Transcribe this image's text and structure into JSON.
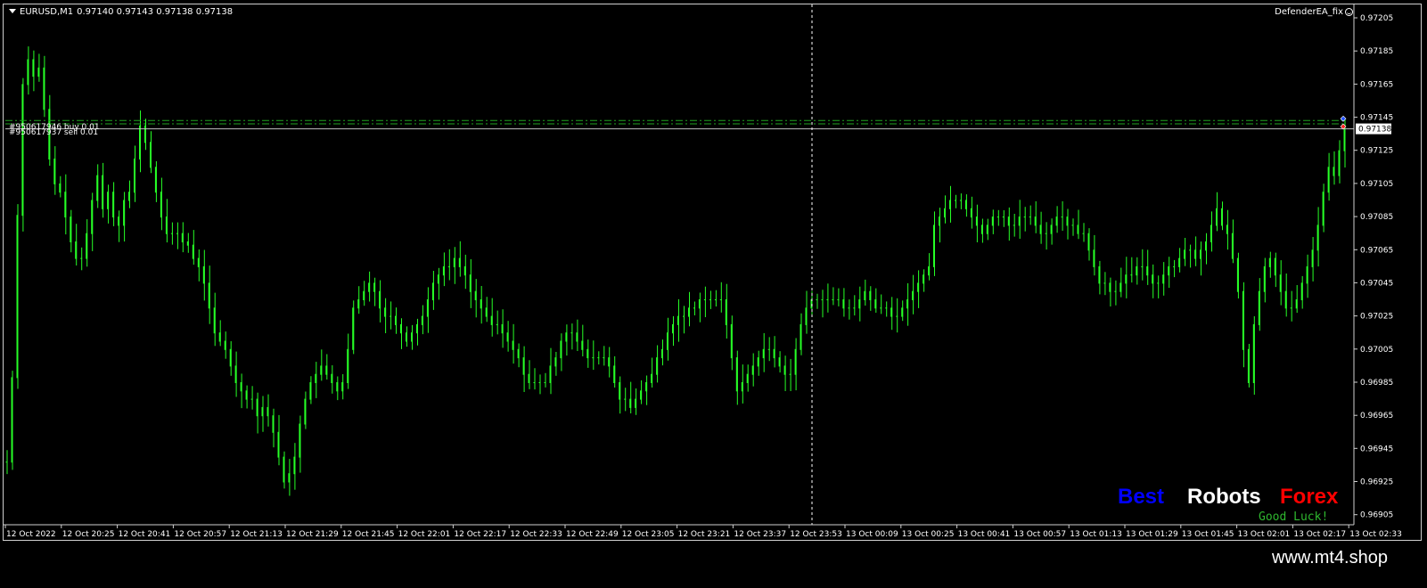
{
  "header": {
    "symbol": "EURUSD,M1",
    "prices": "0.97140 0.97143 0.97138 0.97138",
    "ea_name": "DefenderEA_fix"
  },
  "orders": [
    {
      "label": "#950617946 buy 0.01",
      "price": 0.97143
    },
    {
      "label": "#950617937 sell 0.01",
      "price": 0.97141
    }
  ],
  "current_price_label": "0.97138",
  "brand": {
    "word1": "Best",
    "word1_color": "#0000ff",
    "word2": "Robots",
    "word2_color": "#ffffff",
    "word3": "Forex",
    "word3_color": "#ff0000",
    "subtitle": "Good Luck!",
    "subtitle_color": "#2fb82f"
  },
  "footer": {
    "site": "www.mt4.shop"
  },
  "colors": {
    "candle": "#26ff26",
    "order_line": "#1fa31f",
    "bid_line": "#c0c0c0",
    "grid_text": "#ffffff"
  },
  "chart_data": {
    "type": "candlestick",
    "y_ticks": [
      "0.97205",
      "0.97185",
      "0.97165",
      "0.97145",
      "0.97125",
      "0.97105",
      "0.97085",
      "0.97065",
      "0.97045",
      "0.97025",
      "0.97005",
      "0.96985",
      "0.96965",
      "0.96945",
      "0.96925",
      "0.96905"
    ],
    "ylim": [
      0.969,
      0.97212
    ],
    "x_ticks": [
      "12 Oct 2022",
      "12 Oct 20:25",
      "12 Oct 20:41",
      "12 Oct 20:57",
      "12 Oct 21:13",
      "12 Oct 21:29",
      "12 Oct 21:45",
      "12 Oct 22:01",
      "12 Oct 22:17",
      "12 Oct 22:33",
      "12 Oct 22:49",
      "12 Oct 23:05",
      "12 Oct 23:21",
      "12 Oct 23:37",
      "12 Oct 23:53",
      "13 Oct 00:09",
      "13 Oct 00:25",
      "13 Oct 00:41",
      "13 Oct 00:57",
      "13 Oct 01:13",
      "13 Oct 01:29",
      "13 Oct 01:45",
      "13 Oct 02:01",
      "13 Oct 02:17",
      "13 Oct 02:33"
    ],
    "series": [
      {
        "name": "EURUSD,M1",
        "values": [
          0.96937,
          0.96988,
          0.97086,
          0.97165,
          0.9718,
          0.9717,
          0.97175,
          0.9715,
          0.9712,
          0.97105,
          0.971,
          0.97085,
          0.9707,
          0.9706,
          0.9706,
          0.97075,
          0.97095,
          0.9711,
          0.9709,
          0.971,
          0.97085,
          0.9708,
          0.97095,
          0.971,
          0.9712,
          0.9714,
          0.9713,
          0.97115,
          0.971,
          0.97085,
          0.97075,
          0.97075,
          0.97075,
          0.9707,
          0.97068,
          0.9706,
          0.97055,
          0.97045,
          0.9703,
          0.97015,
          0.9701,
          0.97005,
          0.96995,
          0.96985,
          0.9698,
          0.96975,
          0.96975,
          0.96965,
          0.9697,
          0.96965,
          0.96955,
          0.9694,
          0.96925,
          0.9693,
          0.9694,
          0.9696,
          0.96975,
          0.96985,
          0.9699,
          0.96995,
          0.9699,
          0.96985,
          0.9698,
          0.96985,
          0.97005,
          0.9703,
          0.97035,
          0.9704,
          0.97045,
          0.9704,
          0.9703,
          0.97025,
          0.97025,
          0.9702,
          0.97015,
          0.9701,
          0.97015,
          0.9702,
          0.97025,
          0.97035,
          0.97045,
          0.9705,
          0.97055,
          0.97055,
          0.9706,
          0.97055,
          0.9705,
          0.9704,
          0.97035,
          0.9703,
          0.97025,
          0.9702,
          0.9702,
          0.97015,
          0.9701,
          0.97005,
          0.97,
          0.9699,
          0.96985,
          0.96985,
          0.96985,
          0.96985,
          0.96995,
          0.97,
          0.9701,
          0.97015,
          0.97015,
          0.9701,
          0.97005,
          0.97,
          0.97,
          0.97,
          0.97,
          0.96995,
          0.96985,
          0.96975,
          0.96975,
          0.9697,
          0.96975,
          0.9698,
          0.96985,
          0.9699,
          0.97,
          0.97005,
          0.97015,
          0.9702,
          0.97025,
          0.97025,
          0.9703,
          0.9703,
          0.97035,
          0.97035,
          0.97035,
          0.97035,
          0.97035,
          0.9702,
          0.97,
          0.9698,
          0.96985,
          0.9699,
          0.96995,
          0.97,
          0.97005,
          0.97005,
          0.97,
          0.96995,
          0.9699,
          0.9699,
          0.97005,
          0.9702,
          0.9703,
          0.97035,
          0.97035,
          0.97035,
          0.97035,
          0.97035,
          0.97035,
          0.9703,
          0.9703,
          0.9703,
          0.97035,
          0.9704,
          0.97035,
          0.9703,
          0.9703,
          0.9703,
          0.97025,
          0.97025,
          0.9703,
          0.97035,
          0.9704,
          0.97045,
          0.9705,
          0.97055,
          0.9708,
          0.97085,
          0.9709,
          0.97095,
          0.97095,
          0.97095,
          0.9709,
          0.97085,
          0.9708,
          0.97075,
          0.9708,
          0.97085,
          0.97085,
          0.97085,
          0.9708,
          0.9708,
          0.97085,
          0.97085,
          0.97085,
          0.9708,
          0.97075,
          0.97075,
          0.9708,
          0.97085,
          0.97085,
          0.9708,
          0.9708,
          0.97075,
          0.97075,
          0.97065,
          0.97055,
          0.97045,
          0.97045,
          0.9704,
          0.9704,
          0.97045,
          0.9705,
          0.9705,
          0.97055,
          0.97055,
          0.9705,
          0.97045,
          0.97045,
          0.9705,
          0.97055,
          0.97055,
          0.9706,
          0.97065,
          0.97065,
          0.9706,
          0.97065,
          0.9707,
          0.9708,
          0.9709,
          0.9708,
          0.97075,
          0.9706,
          0.9704,
          0.97005,
          0.96985,
          0.9702,
          0.9704,
          0.97055,
          0.9706,
          0.9705,
          0.9704,
          0.9703,
          0.9703,
          0.97035,
          0.97045,
          0.97055,
          0.97065,
          0.9708,
          0.971,
          0.97115,
          0.9711,
          0.97125,
          0.97138
        ]
      }
    ]
  }
}
